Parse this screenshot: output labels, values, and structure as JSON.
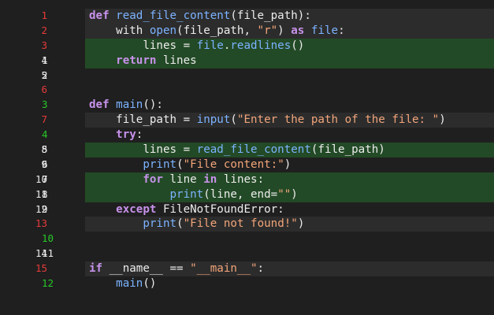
{
  "colors": {
    "background": "#1f1f1f",
    "removed_line_bg": "#2c2c2c",
    "added_line_bg": "#234a26",
    "removed_number": "#e63a3a",
    "added_number": "#28c828",
    "keyword": "#c792ea",
    "function": "#7cb3ff",
    "string": "#f2a57a",
    "text": "#ececec"
  },
  "lines": [
    {
      "old": "1",
      "new": "",
      "type": "removed",
      "tokens": [
        [
          "kw",
          "def "
        ],
        [
          "fn",
          "read_file_content"
        ],
        [
          "p",
          "(file_path):"
        ]
      ]
    },
    {
      "old": "2",
      "new": "",
      "type": "removed",
      "tokens": [
        [
          "p",
          "    with "
        ],
        [
          "fn",
          "open"
        ],
        [
          "p",
          "(file_path, "
        ],
        [
          "str",
          "\"r\""
        ],
        [
          "p",
          ") "
        ],
        [
          "kw",
          "as "
        ],
        [
          "fn",
          "file"
        ],
        [
          "p",
          ":"
        ]
      ]
    },
    {
      "old": "3",
      "new": "",
      "type": "removed-hl",
      "tokens": [
        [
          "p",
          "        lines = "
        ],
        [
          "fn",
          "file"
        ],
        [
          "p",
          "."
        ],
        [
          "fn",
          "readlines"
        ],
        [
          "p",
          "()"
        ]
      ]
    },
    {
      "old": "4",
      "new": "1",
      "type": "context-hl",
      "tokens": [
        [
          "p",
          "    "
        ],
        [
          "kw",
          "return "
        ],
        [
          "p",
          "lines"
        ]
      ]
    },
    {
      "old": "5",
      "new": "2",
      "type": "context",
      "tokens": []
    },
    {
      "old": "6",
      "new": "",
      "type": "removed",
      "tokens": []
    },
    {
      "old": "",
      "new": "3",
      "type": "added",
      "tokens": [
        [
          "kw",
          "def "
        ],
        [
          "fn",
          "main"
        ],
        [
          "p",
          "():"
        ]
      ]
    },
    {
      "old": "7",
      "new": "",
      "type": "removed",
      "tokens": [
        [
          "p",
          "    file_path = "
        ],
        [
          "fn",
          "input"
        ],
        [
          "p",
          "("
        ],
        [
          "str",
          "\"Enter the path of the file: \""
        ],
        [
          "p",
          ")"
        ]
      ]
    },
    {
      "old": "",
      "new": "4",
      "type": "added",
      "tokens": [
        [
          "p",
          "    "
        ],
        [
          "kw",
          "try"
        ],
        [
          "p",
          ":"
        ]
      ]
    },
    {
      "old": "8",
      "new": "5",
      "type": "context-hl",
      "tokens": [
        [
          "p",
          "        lines = "
        ],
        [
          "fn",
          "read_file_content"
        ],
        [
          "p",
          "(file_path)"
        ]
      ]
    },
    {
      "old": "9",
      "new": "6",
      "type": "context",
      "tokens": [
        [
          "p",
          "        "
        ],
        [
          "fn",
          "print"
        ],
        [
          "p",
          "("
        ],
        [
          "str",
          "\"File content:\""
        ],
        [
          "p",
          ")"
        ]
      ]
    },
    {
      "old": "10",
      "new": "7",
      "type": "context-hl",
      "tokens": [
        [
          "p",
          "        "
        ],
        [
          "kw",
          "for "
        ],
        [
          "p",
          "line "
        ],
        [
          "kw",
          "in "
        ],
        [
          "p",
          "lines:"
        ]
      ]
    },
    {
      "old": "11",
      "new": "8",
      "type": "context-hl",
      "tokens": [
        [
          "p",
          "            "
        ],
        [
          "fn",
          "print"
        ],
        [
          "p",
          "(line, end="
        ],
        [
          "str",
          "\"\""
        ],
        [
          "p",
          ")"
        ]
      ]
    },
    {
      "old": "12",
      "new": "9",
      "type": "context",
      "tokens": [
        [
          "p",
          "    "
        ],
        [
          "kw",
          "except "
        ],
        [
          "p",
          "FileNotFoundError:"
        ]
      ]
    },
    {
      "old": "13",
      "new": "",
      "type": "removed",
      "tokens": [
        [
          "p",
          "        "
        ],
        [
          "fn",
          "print"
        ],
        [
          "p",
          "("
        ],
        [
          "str",
          "\"File not found!\""
        ],
        [
          "p",
          ")"
        ]
      ]
    },
    {
      "old": "",
      "new": "10",
      "type": "added",
      "tokens": []
    },
    {
      "old": "14",
      "new": "11",
      "type": "context",
      "tokens": []
    },
    {
      "old": "15",
      "new": "",
      "type": "removed",
      "tokens": [
        [
          "kw",
          "if "
        ],
        [
          "p",
          "__name__ == "
        ],
        [
          "str",
          "\"__main__\""
        ],
        [
          "p",
          ":"
        ]
      ]
    },
    {
      "old": "",
      "new": "12",
      "type": "added",
      "tokens": [
        [
          "p",
          "    "
        ],
        [
          "fn",
          "main"
        ],
        [
          "p",
          "()"
        ]
      ]
    }
  ]
}
